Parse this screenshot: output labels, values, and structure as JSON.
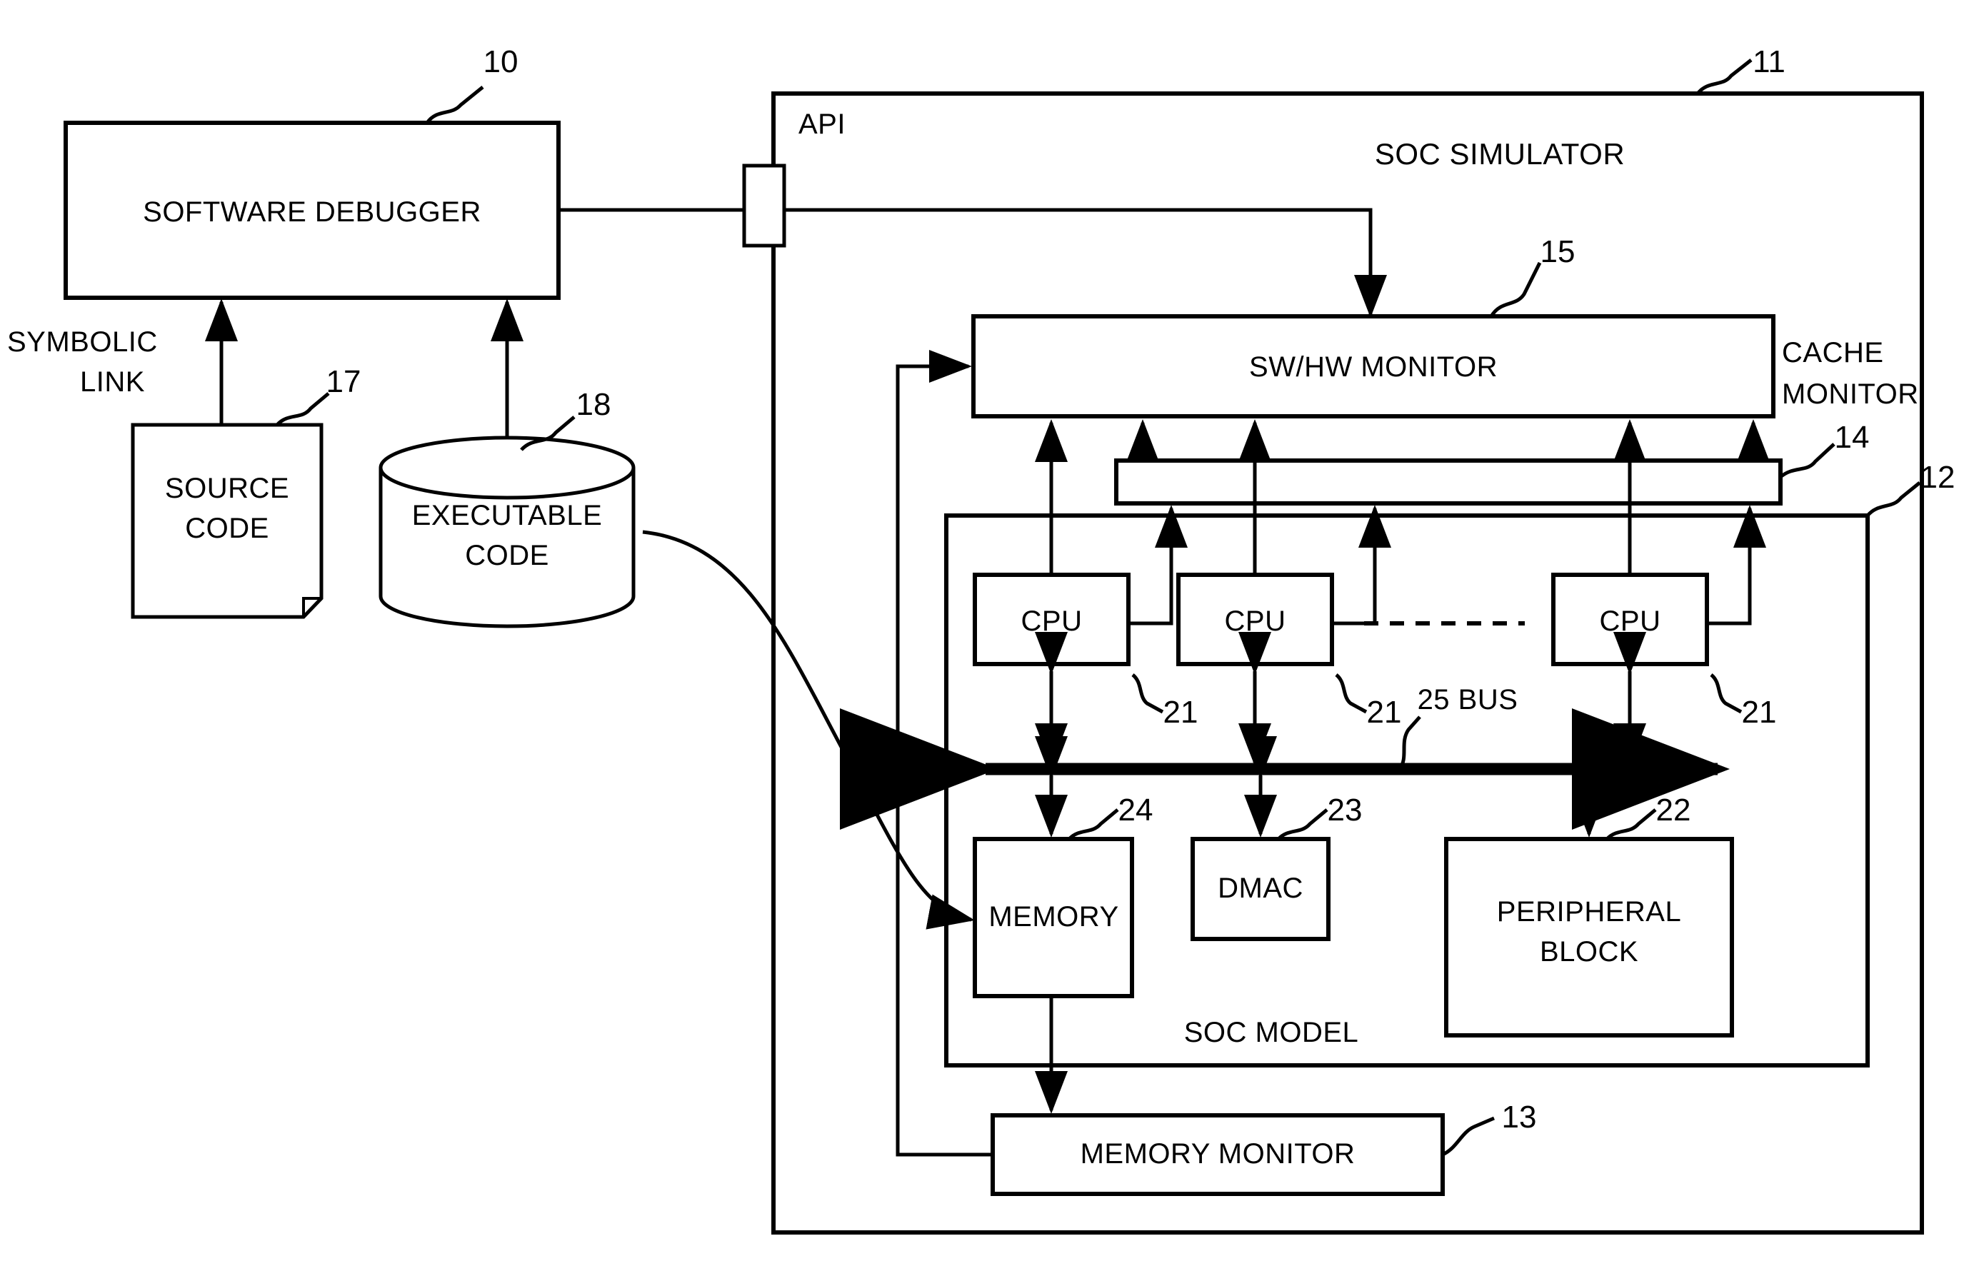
{
  "figure": {
    "type": "patent-block-diagram",
    "title_text": "SOC SIMULATOR",
    "api_label": "API"
  },
  "blocks": {
    "software_debugger": {
      "label": "SOFTWARE DEBUGGER",
      "ref": "10"
    },
    "source_code": {
      "label": "SOURCE\nCODE",
      "ref": "17"
    },
    "executable_code": {
      "label": "EXECUTABLE\nCODE",
      "ref": "18"
    },
    "soc_simulator": {
      "label": "SOC SIMULATOR",
      "ref": "11"
    },
    "swhw_monitor": {
      "label": "SW/HW MONITOR",
      "ref": "15"
    },
    "cache_monitor": {
      "label": "CACHE\nMONITOR",
      "ref": "14"
    },
    "soc_model": {
      "label": "SOC MODEL",
      "ref": "12"
    },
    "cpu_1": {
      "label": "CPU",
      "ref": "21"
    },
    "cpu_2": {
      "label": "CPU",
      "ref": "21"
    },
    "cpu_3": {
      "label": "CPU",
      "ref": "21"
    },
    "bus": {
      "label": "25 BUS",
      "ref": "25"
    },
    "memory": {
      "label": "MEMORY",
      "ref": "24"
    },
    "dmac": {
      "label": "DMAC",
      "ref": "23"
    },
    "peripheral_block": {
      "label": "PERIPHERAL\nBLOCK",
      "ref": "22"
    },
    "memory_monitor": {
      "label": "MEMORY MONITOR",
      "ref": "13"
    }
  },
  "labels": {
    "symbolic_link": "SYMBOLIC\nLINK",
    "api": "API",
    "cache_monitor_1": "CACHE",
    "cache_monitor_2": "MONITOR",
    "source_code_1": "SOURCE",
    "source_code_2": "CODE",
    "executable_code_1": "EXECUTABLE",
    "executable_code_2": "CODE",
    "peripheral_1": "PERIPHERAL",
    "peripheral_2": "BLOCK",
    "symbolic_1": "SYMBOLIC",
    "symbolic_2": "LINK"
  },
  "refs": {
    "r10": "10",
    "r11": "11",
    "r12": "12",
    "r13": "13",
    "r14": "14",
    "r15": "15",
    "r17": "17",
    "r18": "18",
    "r21a": "21",
    "r21b": "21",
    "r21c": "21",
    "r22": "22",
    "r23": "23",
    "r24": "24"
  },
  "colors": {
    "stroke": "#000000",
    "background": "#ffffff"
  }
}
